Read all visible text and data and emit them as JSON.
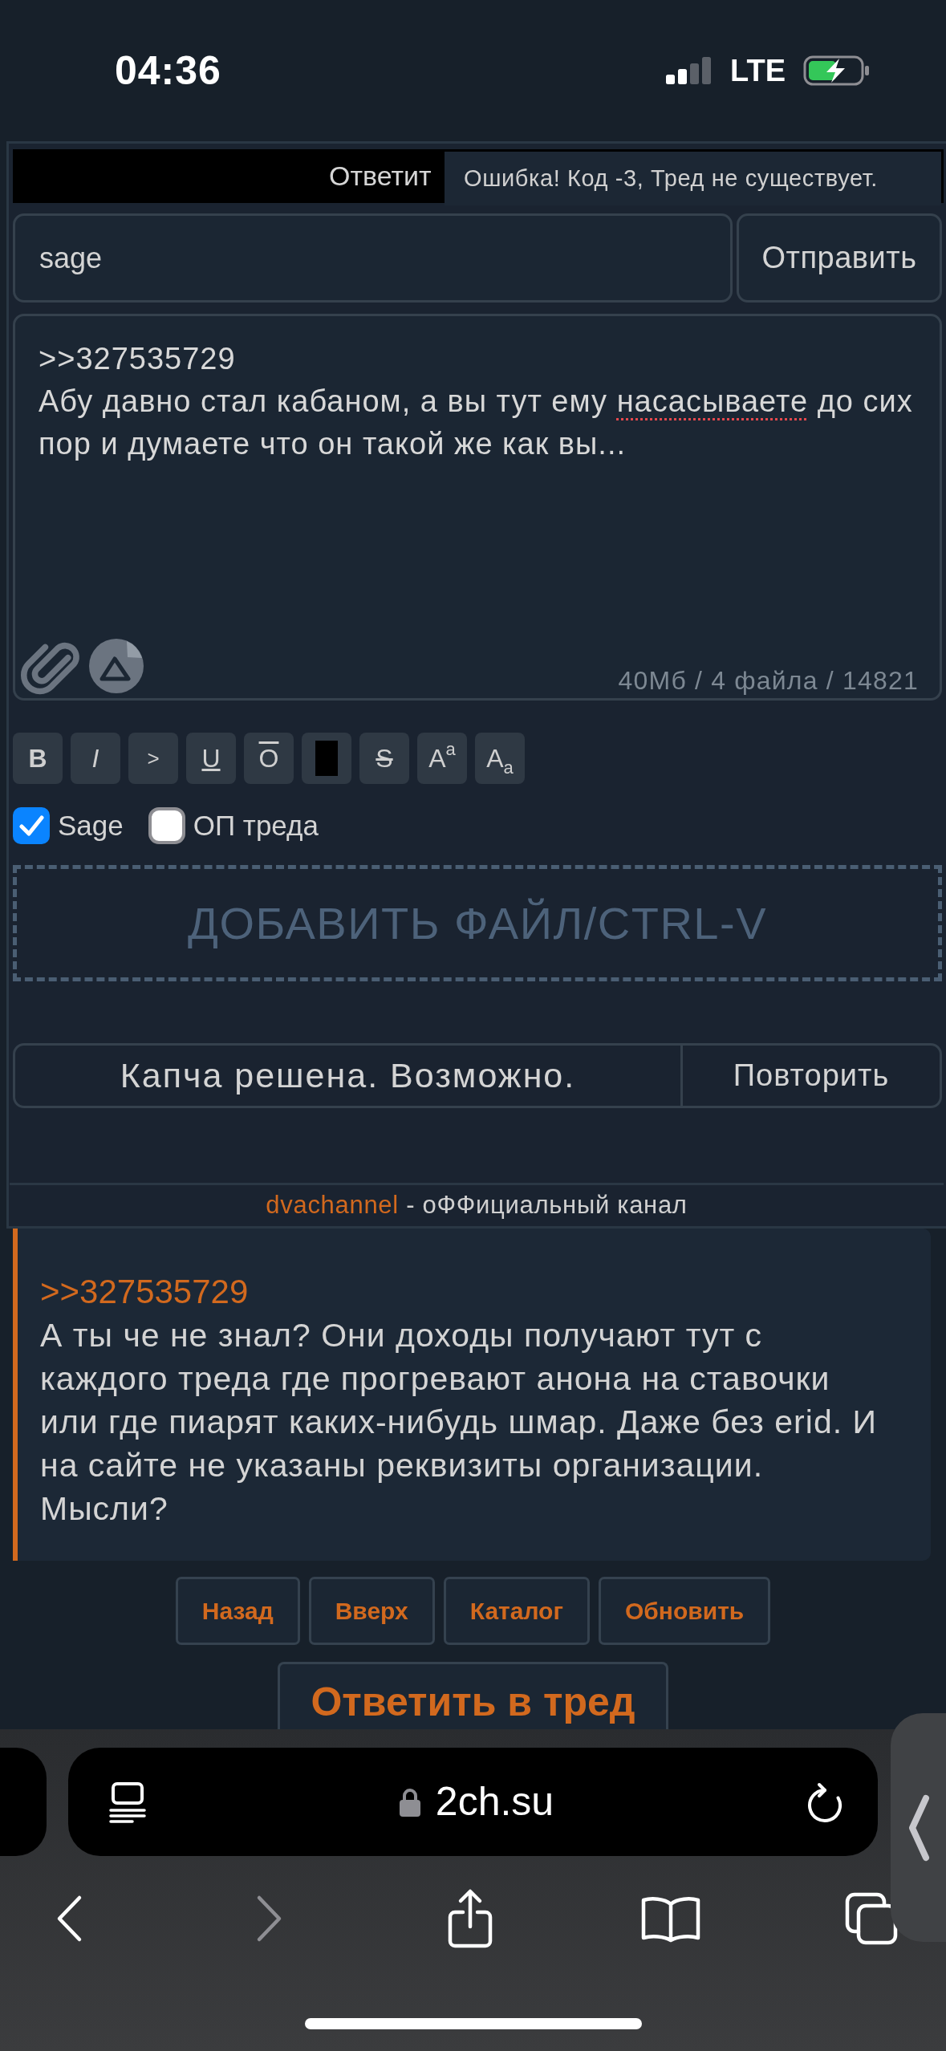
{
  "status_bar": {
    "time": "04:36",
    "network": "LTE"
  },
  "reply_form": {
    "title": "Ответит",
    "tooltip": "Ошибка! Код -3, Тред не существует.",
    "options_field": {
      "value": "sage"
    },
    "send_button": "Отправить",
    "message": {
      "parts": [
        {
          "text": ">>327535729\nАбу давно стал кабаном, а вы тут ему ",
          "misspelled": false
        },
        {
          "text": "насасываете",
          "misspelled": true
        },
        {
          "text": " до сих пор и думаете что он такой же как вы...",
          "misspelled": false
        }
      ],
      "counter": "40Мб / 4 файла / 14821"
    },
    "markup_buttons": [
      {
        "kind": "bold",
        "label": "B"
      },
      {
        "kind": "italic",
        "label": "I"
      },
      {
        "kind": "quote",
        "label": ">"
      },
      {
        "kind": "underline",
        "label": "U"
      },
      {
        "kind": "overline",
        "label": "O"
      },
      {
        "kind": "spoiler"
      },
      {
        "kind": "strike",
        "label": "S"
      },
      {
        "kind": "sup",
        "label": "A$^{a}$"
      },
      {
        "kind": "sub",
        "label": "A$_{a}$"
      }
    ],
    "checkboxes": [
      {
        "label": "Sage",
        "checked": true
      },
      {
        "label": "ОП треда",
        "checked": false
      }
    ],
    "dropzone": "ДОБАВИТЬ ФАЙЛ/CTRL-V",
    "captcha": {
      "status": "Капча решена. Возможно.",
      "retry_button": "Повторить"
    },
    "footer": {
      "link": "dvachannel",
      "text": "- оФФициальный канал"
    }
  },
  "post": {
    "reply_link": ">>327535729",
    "text": "А ты че не знал? Они доходы получают тут с каждого треда где прогревают анона на ставочки или где пиарят каких-нибудь шмар. Даже без erid. И на сайте не указаны реквизиты организации. Мысли?"
  },
  "nav_buttons": [
    "Назад",
    "Вверх",
    "Каталог",
    "Обновить"
  ],
  "reply_button": "Ответить в тред",
  "browser": {
    "url": "2ch.su",
    "toolbar": [
      {
        "kind": "back",
        "disabled": false
      },
      {
        "kind": "forward",
        "disabled": true
      },
      {
        "kind": "share",
        "disabled": false
      },
      {
        "kind": "bookmarks",
        "disabled": false
      },
      {
        "kind": "tabs",
        "disabled": false
      }
    ]
  }
}
